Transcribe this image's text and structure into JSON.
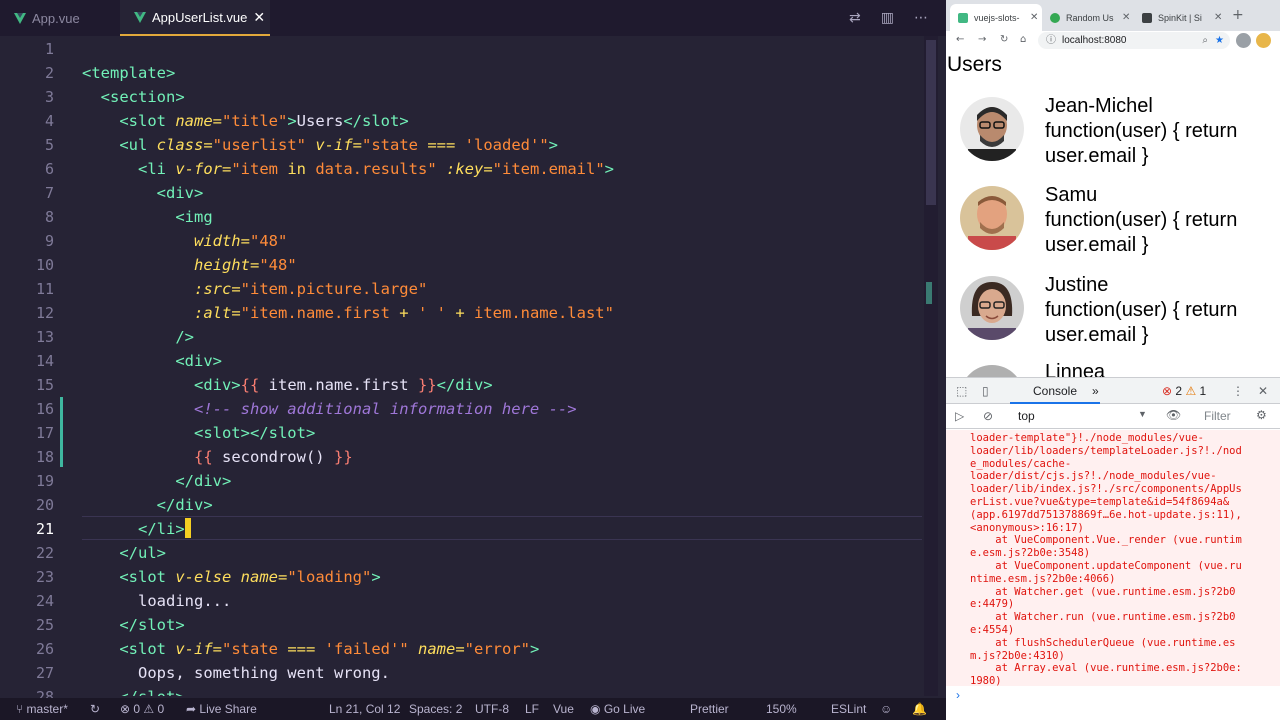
{
  "editor": {
    "tabs": [
      {
        "label": "App.vue"
      },
      {
        "label": "AppUserList.vue",
        "close": "✕"
      }
    ],
    "tabbar_icons": [
      "compare-icon",
      "split-editor-icon",
      "more-actions-icon"
    ],
    "line_numbers": [
      "1",
      "2",
      "3",
      "4",
      "5",
      "6",
      "7",
      "8",
      "9",
      "10",
      "11",
      "12",
      "13",
      "14",
      "15",
      "16",
      "17",
      "18",
      "19",
      "20",
      "21",
      "22",
      "23",
      "24",
      "25",
      "26",
      "27",
      "28"
    ],
    "lines": [
      [],
      [
        [
          "tg",
          "<template>"
        ]
      ],
      [
        [
          "pl",
          "  "
        ],
        [
          "tg",
          "<section>"
        ]
      ],
      [
        [
          "pl",
          "    "
        ],
        [
          "tg",
          "<slot "
        ],
        [
          "at",
          "name"
        ],
        [
          "op",
          "="
        ],
        [
          "st",
          "\"title\""
        ],
        [
          "tg",
          ">"
        ],
        [
          "pl",
          "Users"
        ],
        [
          "tg",
          "</slot>"
        ]
      ],
      [
        [
          "pl",
          "    "
        ],
        [
          "tg",
          "<ul "
        ],
        [
          "at",
          "class"
        ],
        [
          "op",
          "="
        ],
        [
          "st",
          "\"userlist\" "
        ],
        [
          "at",
          "v-if"
        ],
        [
          "op",
          "="
        ],
        [
          "st",
          "\"state "
        ],
        [
          "op",
          "==="
        ],
        [
          "st",
          " 'loaded'\""
        ],
        [
          "tg",
          ">"
        ]
      ],
      [
        [
          "pl",
          "      "
        ],
        [
          "tg",
          "<li "
        ],
        [
          "at",
          "v-for"
        ],
        [
          "op",
          "="
        ],
        [
          "st",
          "\"item "
        ],
        [
          "kw",
          "in"
        ],
        [
          "st",
          " data.results\" "
        ],
        [
          "at",
          ":key"
        ],
        [
          "op",
          "="
        ],
        [
          "st",
          "\"item.email\""
        ],
        [
          "tg",
          ">"
        ]
      ],
      [
        [
          "pl",
          "        "
        ],
        [
          "tg",
          "<div>"
        ]
      ],
      [
        [
          "pl",
          "          "
        ],
        [
          "tg",
          "<img"
        ]
      ],
      [
        [
          "pl",
          "            "
        ],
        [
          "at",
          "width"
        ],
        [
          "op",
          "="
        ],
        [
          "st",
          "\"48\""
        ]
      ],
      [
        [
          "pl",
          "            "
        ],
        [
          "at",
          "height"
        ],
        [
          "op",
          "="
        ],
        [
          "st",
          "\"48\""
        ]
      ],
      [
        [
          "pl",
          "            "
        ],
        [
          "at",
          ":src"
        ],
        [
          "op",
          "="
        ],
        [
          "st",
          "\"item.picture.large\""
        ]
      ],
      [
        [
          "pl",
          "            "
        ],
        [
          "at",
          ":alt"
        ],
        [
          "op",
          "="
        ],
        [
          "st",
          "\"item.name.first "
        ],
        [
          "op",
          "+"
        ],
        [
          "st",
          " ' ' "
        ],
        [
          "op",
          "+"
        ],
        [
          "st",
          " item.name.last\""
        ]
      ],
      [
        [
          "pl",
          "          "
        ],
        [
          "tg",
          "/>"
        ]
      ],
      [
        [
          "pl",
          "          "
        ],
        [
          "tg",
          "<div>"
        ]
      ],
      [
        [
          "pl",
          "            "
        ],
        [
          "tg",
          "<div>"
        ],
        [
          "br",
          "{{"
        ],
        [
          "pl",
          " item.name.first "
        ],
        [
          "br",
          "}}"
        ],
        [
          "tg",
          "</div>"
        ]
      ],
      [
        [
          "pl",
          "            "
        ],
        [
          "cm",
          "<!-- show additional information here -->"
        ]
      ],
      [
        [
          "pl",
          "            "
        ],
        [
          "tg",
          "<slot></slot>"
        ]
      ],
      [
        [
          "pl",
          "            "
        ],
        [
          "br",
          "{{"
        ],
        [
          "pl",
          " secondrow() "
        ],
        [
          "br",
          "}}"
        ]
      ],
      [
        [
          "pl",
          "          "
        ],
        [
          "tg",
          "</div>"
        ]
      ],
      [
        [
          "pl",
          "        "
        ],
        [
          "tg",
          "</div>"
        ]
      ],
      [
        [
          "pl",
          "      "
        ],
        [
          "tg",
          "</li>"
        ]
      ],
      [
        [
          "pl",
          "    "
        ],
        [
          "tg",
          "</ul>"
        ]
      ],
      [
        [
          "pl",
          "    "
        ],
        [
          "tg",
          "<slot "
        ],
        [
          "at",
          "v-else"
        ],
        [
          "pl",
          " "
        ],
        [
          "at",
          "name"
        ],
        [
          "op",
          "="
        ],
        [
          "st",
          "\"loading\""
        ],
        [
          "tg",
          ">"
        ]
      ],
      [
        [
          "pl",
          "      loading..."
        ]
      ],
      [
        [
          "pl",
          "    "
        ],
        [
          "tg",
          "</slot>"
        ]
      ],
      [
        [
          "pl",
          "    "
        ],
        [
          "tg",
          "<slot "
        ],
        [
          "at",
          "v-if"
        ],
        [
          "op",
          "="
        ],
        [
          "st",
          "\"state "
        ],
        [
          "op",
          "==="
        ],
        [
          "st",
          " 'failed'\" "
        ],
        [
          "at",
          "name"
        ],
        [
          "op",
          "="
        ],
        [
          "st",
          "\"error\""
        ],
        [
          "tg",
          ">"
        ]
      ],
      [
        [
          "pl",
          "      Oops, something went wrong."
        ]
      ],
      [
        [
          "pl",
          "    "
        ],
        [
          "tg",
          "</slot>"
        ]
      ]
    ]
  },
  "statusbar": {
    "branch": "master*",
    "sync_icon": "sync-icon",
    "errors": "0",
    "warnings": "0",
    "live_share": "Live Share",
    "position": "Ln 21, Col 12",
    "spaces": "Spaces: 2",
    "encoding": "UTF-8",
    "eol": "LF",
    "language": "Vue",
    "go_live": "Go Live",
    "formatter": "Prettier",
    "zoom": "150%",
    "linter": "ESLint"
  },
  "browser": {
    "tabs": [
      {
        "label": "vuejs-slots-",
        "color": "#41b883"
      },
      {
        "label": "Random Us",
        "color": "#34a853"
      },
      {
        "label": "SpinKit | Si",
        "color": "#3c4043"
      }
    ],
    "new_tab": "+",
    "url": "localhost:8080",
    "page": {
      "title": "Users",
      "users": [
        {
          "first": "Jean-Michel",
          "second": "function(user) { return user.email }"
        },
        {
          "first": "Samu",
          "second": "function(user) { return user.email }"
        },
        {
          "first": "Justine",
          "second": "function(user) { return user.email }"
        },
        {
          "first": "Linnea",
          "second": ""
        }
      ]
    },
    "devtools": {
      "tab_console": "Console",
      "more_tabs": "»",
      "error_count": "2",
      "warning_count": "1",
      "context": "top",
      "filter": "Filter",
      "console_lines": [
        "loader-template\"}!./node_modules/vue-",
        "loader/lib/loaders/templateLoader.js?!./nod",
        "e_modules/cache-",
        "loader/dist/cjs.js?!./node_modules/vue-",
        "loader/lib/index.js?!./src/components/AppUs",
        "erList.vue?vue&type=template&id=54f8694a&",
        "(app.6197dd751378869f…6e.hot-update.js:11),",
        "<anonymous>:16:17)",
        "    at VueComponent.Vue._render (vue.runtim",
        "e.esm.js?2b0e:3548)",
        "    at VueComponent.updateComponent (vue.ru",
        "ntime.esm.js?2b0e:4066)",
        "    at Watcher.get (vue.runtime.esm.js?2b0",
        "e:4479)",
        "    at Watcher.run (vue.runtime.esm.js?2b0",
        "e:4554)",
        "    at flushSchedulerQueue (vue.runtime.es",
        "m.js?2b0e:4310)",
        "    at Array.eval (vue.runtime.esm.js?2b0e:",
        "1980)"
      ],
      "prompt": "›"
    }
  }
}
